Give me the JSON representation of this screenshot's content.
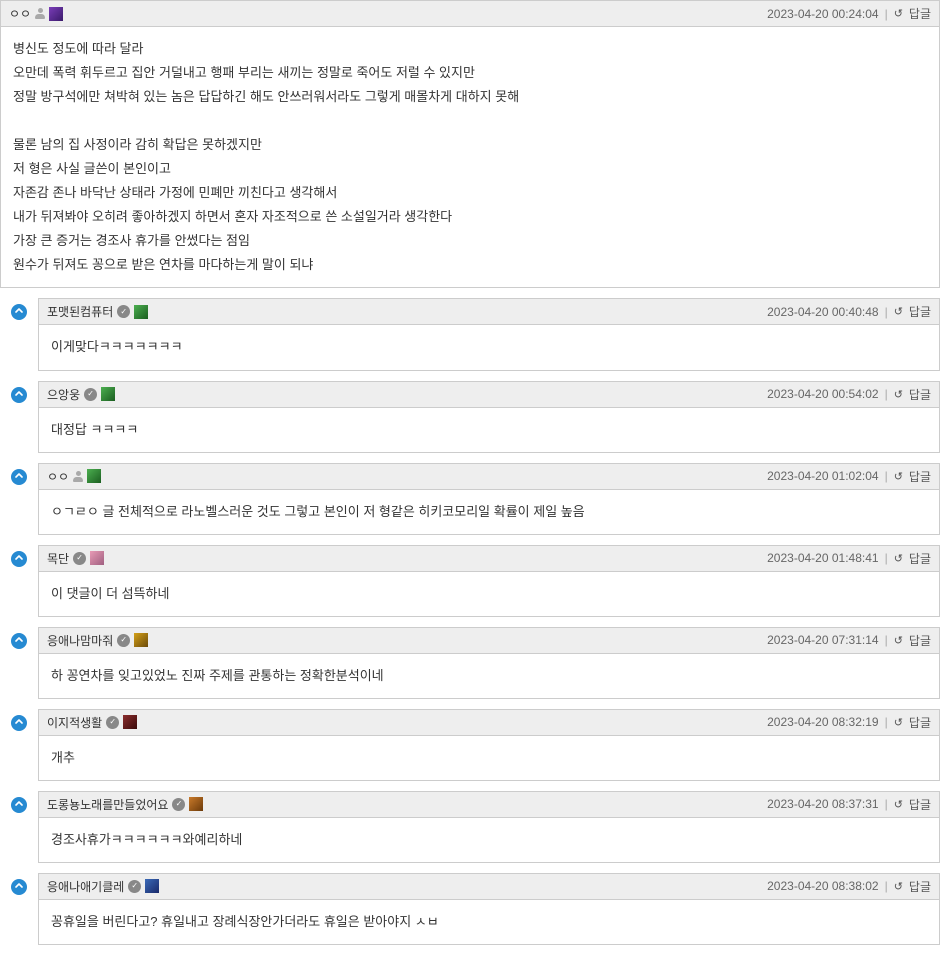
{
  "reply_btn_label": "답글",
  "main_comment": {
    "username": "ㅇㅇ",
    "badge": "badge-purple",
    "timestamp": "2023-04-20 00:24:04",
    "body": "병신도 정도에 따라 달라\n오만데 폭력 휘두르고 집안 거덜내고 행패 부리는 새끼는 정말로 죽어도 저럴 수 있지만\n정말 방구석에만 쳐박혀 있는 놈은 답답하긴 해도 안쓰러워서라도 그렇게 매몰차게 대하지 못해\n\n물론 남의 집 사정이라 감히 확답은 못하겠지만\n저 형은 사실 글쓴이 본인이고\n자존감 존나 바닥난 상태라 가정에 민폐만 끼친다고 생각해서\n내가 뒤져봐야 오히려 좋아하겠지 하면서 혼자 자조적으로 쓴 소설일거라 생각한다\n가장 큰 증거는 경조사 휴가를 안썼다는 점임\n원수가 뒤져도 꽁으로 받은 연차를 마다하는게 말이 되냐"
  },
  "replies": [
    {
      "username": "포맷된컴퓨터",
      "verified": true,
      "badge": "badge-green",
      "timestamp": "2023-04-20 00:40:48",
      "body": "이게맞다ㅋㅋㅋㅋㅋㅋㅋ"
    },
    {
      "username": "으앙웅",
      "verified": true,
      "badge": "badge-green",
      "timestamp": "2023-04-20 00:54:02",
      "body": "대정답 ㅋㅋㅋㅋ"
    },
    {
      "username": "ㅇㅇ",
      "verified": false,
      "anon": true,
      "badge": "badge-green",
      "timestamp": "2023-04-20 01:02:04",
      "body": "ㅇㄱㄹㅇ 글 전체적으로 라노벨스러운 것도 그렇고 본인이 저 형같은 히키코모리일 확률이 제일 높음"
    },
    {
      "username": "목단",
      "verified": true,
      "badge": "badge-pink",
      "timestamp": "2023-04-20 01:48:41",
      "body": "이 댓글이 더 섬뜩하네"
    },
    {
      "username": "응애나맘마줘",
      "verified": true,
      "badge": "badge-gold",
      "timestamp": "2023-04-20 07:31:14",
      "body": "하 꽁연차를 잊고있었노 진짜 주제를 관통하는 정확한분석이네"
    },
    {
      "username": "이지적생활",
      "verified": true,
      "badge": "badge-darkred",
      "timestamp": "2023-04-20 08:32:19",
      "body": "개추"
    },
    {
      "username": "도롱뇽노래를만들었어요",
      "verified": true,
      "badge": "badge-orange",
      "timestamp": "2023-04-20 08:37:31",
      "body": "경조사휴가ㅋㅋㅋㅋㅋㅋ와예리하네"
    },
    {
      "username": "응애나애기클레",
      "verified": true,
      "badge": "badge-blue",
      "timestamp": "2023-04-20 08:38:02",
      "body": "꽁휴일을 버린다고? 휴일내고 장례식장안가더라도 휴일은 받아야지 ㅅㅂ"
    }
  ]
}
